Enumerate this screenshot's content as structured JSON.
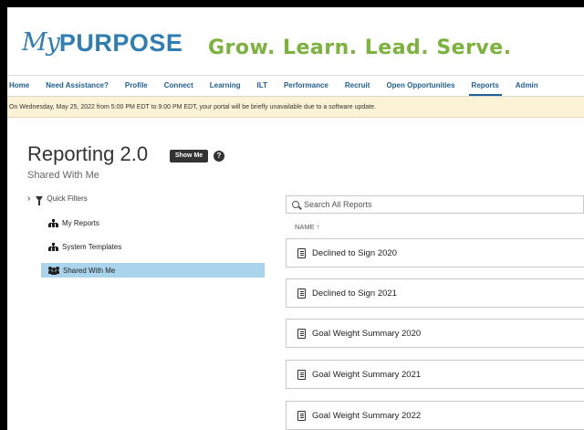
{
  "header": {
    "logo_my": "My",
    "logo_purpose": "PURPOSE",
    "tagline": "Grow. Learn. Lead. Serve."
  },
  "nav": {
    "items": [
      {
        "label": "Home"
      },
      {
        "label": "Need Assistance?"
      },
      {
        "label": "Profile"
      },
      {
        "label": "Connect"
      },
      {
        "label": "Learning"
      },
      {
        "label": "ILT"
      },
      {
        "label": "Performance"
      },
      {
        "label": "Recruit"
      },
      {
        "label": "Open Opportunities"
      },
      {
        "label": "Reports"
      },
      {
        "label": "Admin"
      }
    ],
    "active": "Reports"
  },
  "banner": {
    "text": "On Wednesday, May 25, 2022 from 5:00 PM EDT to 9:00 PM EDT, your portal will be briefly unavailable due to a software update."
  },
  "page": {
    "title": "Reporting 2.0",
    "show_me_label": "Show Me",
    "info_glyph": "?",
    "subtitle": "Shared With Me"
  },
  "sidebar": {
    "chevron": "›",
    "quick_filters_label": "Quick Filters",
    "items": [
      {
        "label": "My Reports",
        "icon": "hierarchy-icon"
      },
      {
        "label": "System Templates",
        "icon": "hierarchy-icon"
      },
      {
        "label": "Shared With Me",
        "icon": "people-icon",
        "selected": true
      }
    ]
  },
  "reports": {
    "search_placeholder": "Search All Reports",
    "column_name": "NAME ↑",
    "items": [
      {
        "name": "Declined to Sign 2020"
      },
      {
        "name": "Declined to Sign 2021"
      },
      {
        "name": "Goal Weight Summary 2020"
      },
      {
        "name": "Goal Weight Summary 2021"
      },
      {
        "name": "Goal Weight Summary 2022"
      }
    ]
  },
  "colors": {
    "brand_blue": "#2e7db4",
    "tagline_green": "#7bb33d",
    "nav_blue": "#1f5e96",
    "banner_bg": "#fcf3d6",
    "selected_bg": "#a9d4ec"
  }
}
